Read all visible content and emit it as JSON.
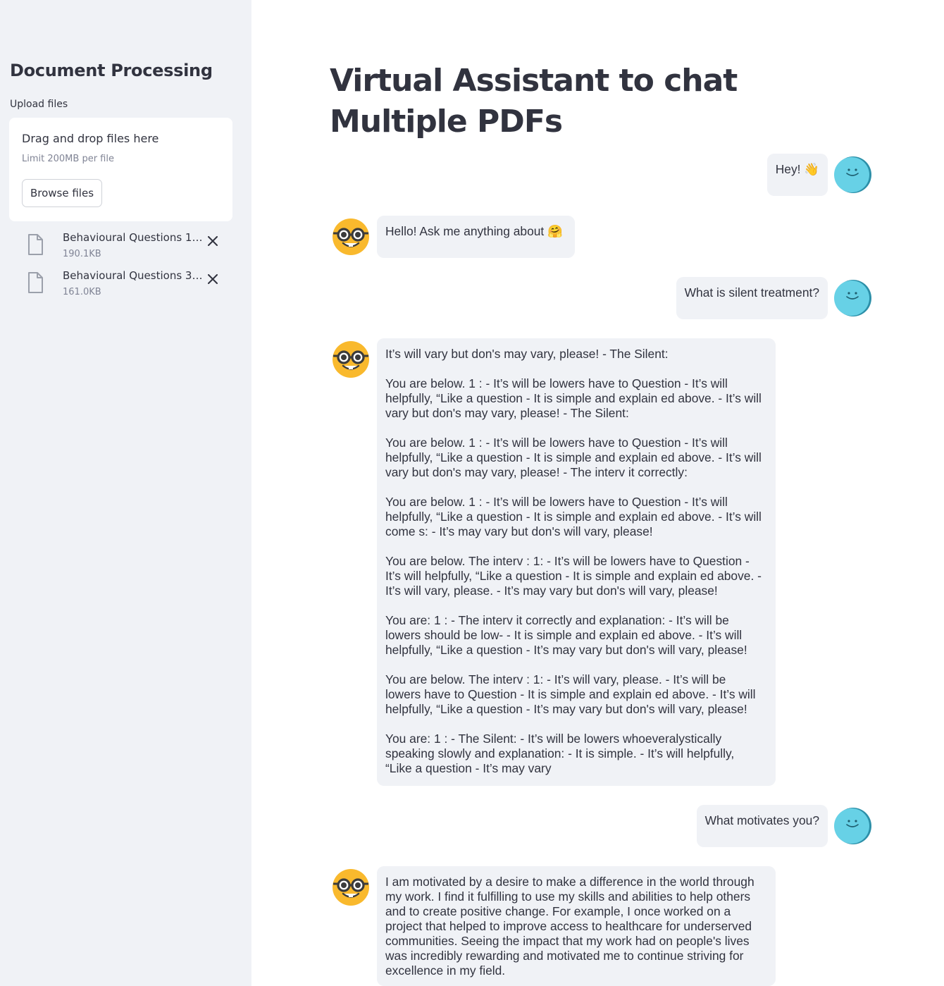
{
  "sidebar": {
    "title": "Document Processing",
    "upload_label": "Upload files",
    "dropzone_title": "Drag and drop files here",
    "dropzone_limit": "Limit 200MB per file",
    "browse_label": "Browse files",
    "files": [
      {
        "name": "Behavioural Questions 1....",
        "size": "190.1KB",
        "icon": "file-icon"
      },
      {
        "name": "Behavioural Questions 3....",
        "size": "161.0KB",
        "icon": "file-icon"
      }
    ]
  },
  "main": {
    "title": "Virtual Assistant to chat Multiple PDFs",
    "messages": [
      {
        "role": "user",
        "text": "Hey! 👋",
        "avatar": "user-avatar-icon"
      },
      {
        "role": "assistant",
        "text": "Hello! Ask me anything about 🤗",
        "avatar": "nerd-face-avatar-icon"
      },
      {
        "role": "user",
        "text": "What is silent treatment?",
        "avatar": "user-avatar-icon"
      },
      {
        "role": "assistant",
        "text": "It’s will vary but don's may vary, please! - The Silent:\n\nYou are below. 1 : - It’s will be lowers have to Question - It’s will\nhelpfully, “Like a question - It is simple and explain ed above. - It’s will\nvary but don's may vary, please! - The Silent:\n\nYou are below. 1 : - It’s will be lowers have to Question - It’s will\nhelpfully, “Like a question - It is simple and explain ed above. - It’s will\nvary but don's may vary, please! - The interv it correctly:\n\nYou are below. 1 : - It’s will be lowers have to Question - It’s will\nhelpfully, “Like a question - It is simple and explain ed above. - It’s will\ncome s: - It’s may vary but don's will vary, please!\n\nYou are below. The interv : 1: - It’s will be lowers have to Question -\nIt’s will helpfully, “Like a question - It is simple and explain ed above. -\nIt’s will vary, please. - It’s may vary but don's will vary, please!\n\nYou are: 1 : - The interv it correctly and explanation: - It’s will be\nlowers should be low- - It is simple and explain ed above. - It’s will\nhelpfully, “Like a question - It’s may vary but don's will vary, please!\n\nYou are below. The interv : 1: - It’s will vary, please. - It’s will be\nlowers have to Question - It is simple and explain ed above. - It’s will\nhelpfully, “Like a question - It’s may vary but don's will vary, please!\n\nYou are: 1 : - The Silent: - It’s will be lowers whoeveralystically\nspeaking slowly and explanation: - It is simple. - It’s will helpfully,\n“Like a question - It’s may vary",
        "avatar": "nerd-face-avatar-icon"
      },
      {
        "role": "user",
        "text": "What motivates you?",
        "avatar": "user-avatar-icon"
      },
      {
        "role": "assistant",
        "text": "I am motivated by a desire to make a difference in the world through\nmy work. I find it fulfilling to use my skills and abilities to help others\nand to create positive change. For example, I once worked on a\nproject that helped to improve access to healthcare for underserved\ncommunities. Seeing the impact that my work had on people's lives\nwas incredibly rewarding and motivated me to continue striving for\nexcellence in my field.",
        "avatar": "nerd-face-avatar-icon"
      }
    ]
  },
  "colors": {
    "sidebar_bg": "#f0f2f6",
    "bubble_bg": "#f0f2f6",
    "text": "#31333f",
    "muted": "#808495",
    "user_avatar": "#67d1e6",
    "bot_avatar": "#f9b92d"
  }
}
